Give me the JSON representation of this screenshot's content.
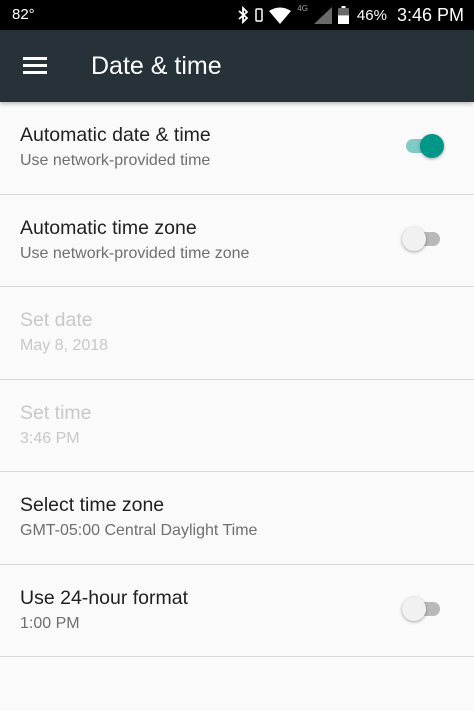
{
  "status_bar": {
    "temperature": "82°",
    "network_label": "4G",
    "battery_percent": "46%",
    "time": "3:46 PM"
  },
  "app_bar": {
    "title": "Date & time"
  },
  "settings": [
    {
      "title": "Automatic date & time",
      "summary": "Use network-provided time",
      "enabled": true,
      "toggle": true
    },
    {
      "title": "Automatic time zone",
      "summary": "Use network-provided time zone",
      "enabled": true,
      "toggle": false
    },
    {
      "title": "Set date",
      "summary": "May 8, 2018",
      "enabled": false
    },
    {
      "title": "Set time",
      "summary": "3:46 PM",
      "enabled": false
    },
    {
      "title": "Select time zone",
      "summary": "GMT-05:00 Central Daylight Time",
      "enabled": true
    },
    {
      "title": "Use 24-hour format",
      "summary": "1:00 PM",
      "enabled": true,
      "toggle": false
    }
  ],
  "colors": {
    "app_bar": "#263238",
    "accent": "#009688",
    "accent_track": "#80cbc4"
  },
  "icons": [
    "menu-icon",
    "bluetooth-icon",
    "vibrate-icon",
    "wifi-icon",
    "signal-icon",
    "battery-icon"
  ]
}
